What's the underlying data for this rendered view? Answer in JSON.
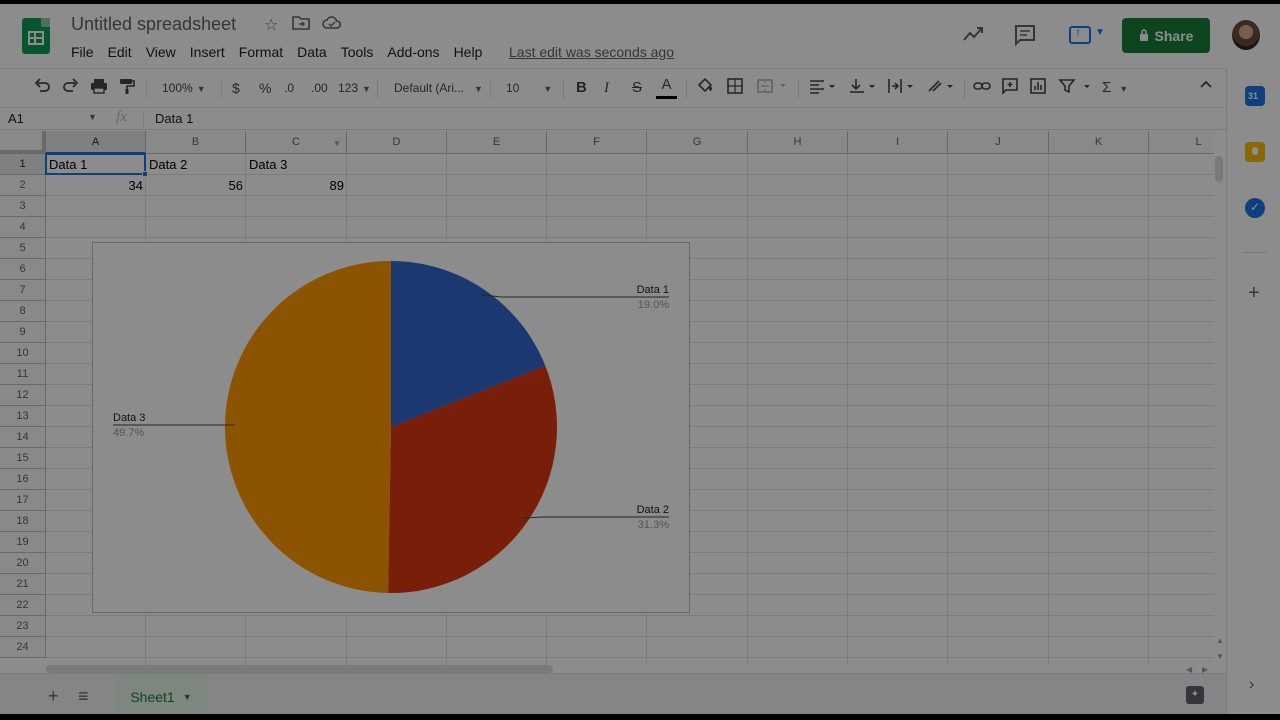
{
  "doc": {
    "title": "Untitled spreadsheet",
    "last_edit": "Last edit was seconds ago",
    "share_label": "Share"
  },
  "menu": [
    "File",
    "Edit",
    "View",
    "Insert",
    "Format",
    "Data",
    "Tools",
    "Add-ons",
    "Help"
  ],
  "toolbar": {
    "zoom": "100%",
    "currency": "$",
    "percent": "%",
    "decrease_decimal": ".0",
    "increase_decimal": ".00",
    "more_formats": "123",
    "font": "Default (Ari...",
    "font_size": "10",
    "bold": "B",
    "italic": "I",
    "strikethrough": "S",
    "text_color": "A",
    "sum": "Σ"
  },
  "formula_bar": {
    "name_box": "A1",
    "fx": "fx",
    "value": "Data 1"
  },
  "columns": [
    "A",
    "B",
    "C",
    "D",
    "E",
    "F",
    "G",
    "H",
    "I",
    "J",
    "K",
    "L"
  ],
  "rows": [
    "1",
    "2",
    "3",
    "4",
    "5",
    "6",
    "7",
    "8",
    "9",
    "10",
    "11",
    "12",
    "13",
    "14",
    "15",
    "16",
    "17",
    "18",
    "19",
    "20",
    "21",
    "22",
    "23",
    "24"
  ],
  "cells": {
    "A1": "Data 1",
    "B1": "Data 2",
    "C1": "Data 3",
    "A2": "34",
    "B2": "56",
    "C2": "89"
  },
  "chart_data": {
    "type": "pie",
    "categories": [
      "Data 1",
      "Data 2",
      "Data 3"
    ],
    "values": [
      34,
      56,
      89
    ],
    "percent_labels": [
      "19.0%",
      "31.3%",
      "49.7%"
    ],
    "colors": [
      "#3366cc",
      "#dc3912",
      "#ff9900"
    ],
    "legend": "labeled"
  },
  "sheets": [
    "Sheet1"
  ],
  "icons": {
    "undo": "undo-icon",
    "redo": "redo-icon",
    "print": "print-icon",
    "paint": "paint-format-icon",
    "star": "star-icon",
    "move": "folder-icon",
    "cloud": "cloud-icon",
    "trend": "trend-icon",
    "comment": "comment-icon"
  }
}
